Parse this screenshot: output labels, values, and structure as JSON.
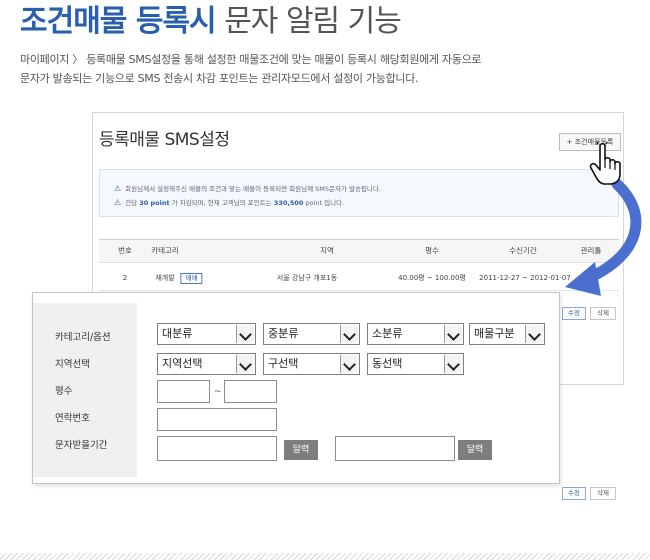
{
  "title": {
    "strong": "조건매물 등록시",
    "light": "문자 알림 기능"
  },
  "description": {
    "line1": "마이페이지 〉 등록매물 SMS설정을 통해 설정한 매물조건에 맞는 매물이 등록시 해당회원에게 자동으로",
    "line2": "문자가 발송되는 기능으로 SMS 전송시 차감 포인트는 관리자모드에서 설정이 가능합니다."
  },
  "panel": {
    "title": "등록매물 SMS설정",
    "add_button": "+ 조건매물등록",
    "notice": {
      "line1": "회원님께서 설정해주신 매물의 조건과 맞는 매물이 등록되면 회원님께 SMS문자가 발송됩니다.",
      "line2_a": "건당",
      "line2_points": "30 point",
      "line2_b": "가 차감되며, 현재 고객님의 포인트는",
      "line2_total": "330,500",
      "line2_c": "point 입니다."
    },
    "columns": [
      "번호",
      "카테고리",
      "지역",
      "평수",
      "수신기간",
      "관리툴"
    ],
    "row": {
      "number": "2",
      "category": "재개발",
      "badge": "매매",
      "region": "서울 강남구 개포1동",
      "area": "40.00평 ~ 100.00평",
      "period": "2011-12-27 ~ 2012-01-07",
      "edit": "수정",
      "delete": "삭제"
    }
  },
  "form": {
    "labels": {
      "category": "카테고리/옵션",
      "region": "지역선택",
      "area": "평수",
      "contact": "연락번호",
      "period": "문자받을기간"
    },
    "category_selects": [
      "대분류",
      "중분류",
      "소분류",
      "매물구분"
    ],
    "region_selects": [
      "지역선택",
      "구선택",
      "동선택"
    ],
    "tilde": "~",
    "calendar_button": "달력"
  },
  "icons": {
    "warning": "warning-triangle-icon",
    "cursor": "hand-pointer-icon",
    "arrow": "curved-arrow-icon"
  },
  "colors": {
    "accent": "#2a5fae",
    "arrow": "#4a6fcf"
  }
}
